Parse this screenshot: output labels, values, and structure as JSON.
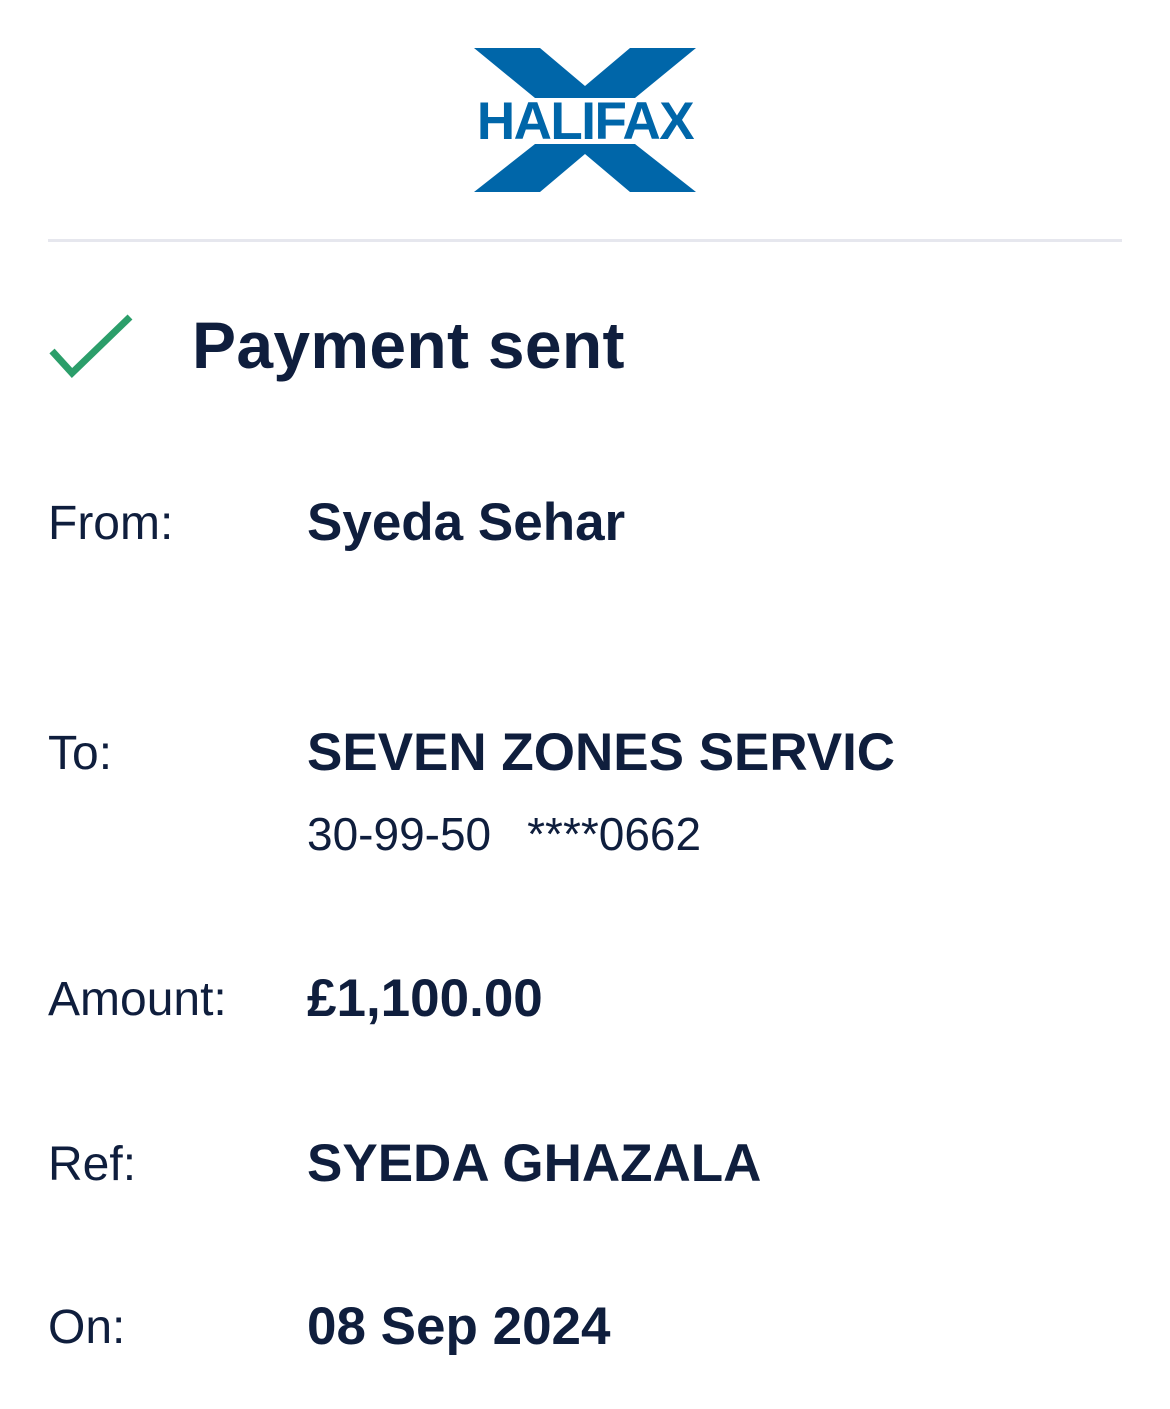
{
  "brand": {
    "logo_text": "HALIFAX",
    "logo_color": "#0066a9",
    "logo_icon": "halifax-x-logo"
  },
  "status": {
    "icon": "check-icon",
    "icon_color": "#2b9e6a",
    "title": "Payment sent"
  },
  "details": {
    "from": {
      "label": "From:",
      "value": "Syeda Sehar"
    },
    "to": {
      "label": "To:",
      "value": "SEVEN ZONES SERVIC",
      "sort_code": "30-99-50",
      "account": "****0662"
    },
    "amount": {
      "label": "Amount:",
      "value": "£1,100.00"
    },
    "ref": {
      "label": "Ref:",
      "value": "SYEDA GHAZALA"
    },
    "on": {
      "label": "On:",
      "value": "08 Sep 2024"
    }
  },
  "colors": {
    "text": "#0f1e3d",
    "divider": "#e6e7ee"
  }
}
